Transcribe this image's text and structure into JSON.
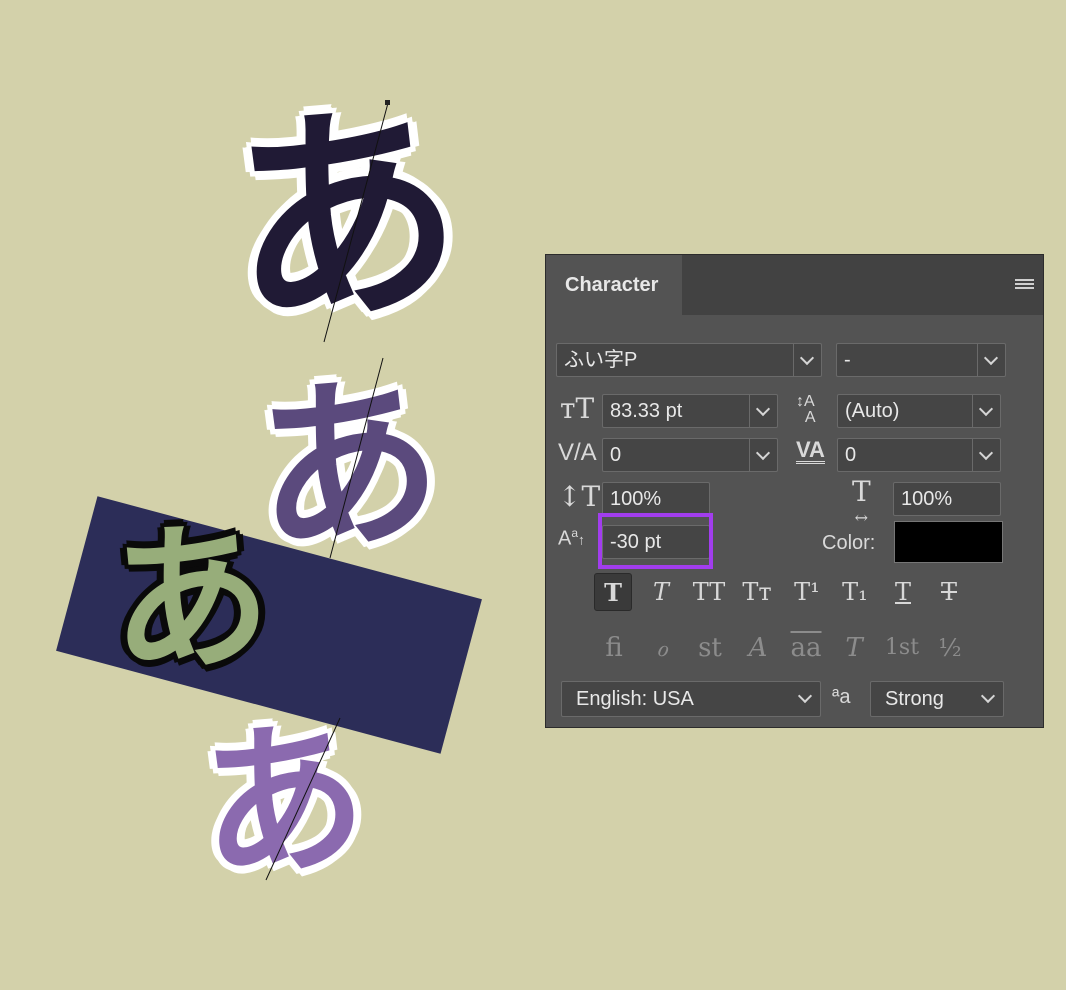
{
  "canvas": {
    "glyph_top": "あ",
    "glyph_mid": "あ",
    "glyph_green": "あ",
    "glyph_bottom": "あ"
  },
  "panel": {
    "tab_label": "Character",
    "font_family": "ふい字P",
    "font_style": "-",
    "font_size": "83.33 pt",
    "leading": "(Auto)",
    "kerning": "0",
    "tracking": "0",
    "vertical_scale": "100%",
    "horizontal_scale": "100%",
    "baseline_shift": "-30 pt",
    "color_label": "Color:",
    "color_value": "#000000",
    "style_buttons": [
      "T",
      "T",
      "TT",
      "Tт",
      "T¹",
      "T₁",
      "T",
      "T"
    ],
    "opentype_buttons": [
      "ﬁ",
      "ℴ",
      "st",
      "A",
      "aa",
      "T",
      "1st",
      "½"
    ],
    "language": "English: USA",
    "antialias_icon": "ªa",
    "antialias": "Strong"
  },
  "colors": {
    "background": "#d3d1aa",
    "highlight": "#a23dee",
    "navy": "#2c2d58"
  }
}
